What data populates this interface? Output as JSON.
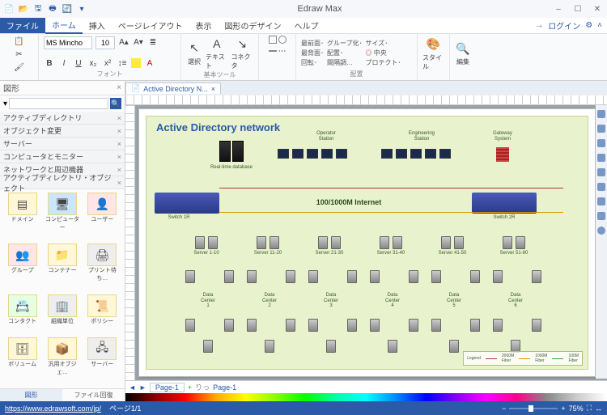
{
  "app": {
    "title": "Edraw Max"
  },
  "window_controls": {
    "min": "–",
    "max": "☐",
    "close": "✕"
  },
  "qat": [
    "📄",
    "📂",
    "🖫",
    "🖶",
    "🔄",
    "▾"
  ],
  "login": {
    "arrow": "→",
    "label": "ログイン"
  },
  "tabs": {
    "file": "ファイル",
    "home": "ホーム",
    "insert": "挿入",
    "pagelayout": "ページレイアウト",
    "view": "表示",
    "design": "図形のデザイン",
    "help": "ヘルプ"
  },
  "ribbon": {
    "font": {
      "name": "MS Mincho",
      "size": "10",
      "bold": "B",
      "italic": "I",
      "underline": "U",
      "label": "フォント"
    },
    "tools": {
      "select": "選択",
      "text": "テキスト",
      "connector": "コネクタ",
      "label": "基本ツール"
    },
    "arrange": {
      "items": [
        "最前面･",
        "グループ化･",
        "サイズ･",
        "最背面･",
        "配置･",
        "中央",
        "回転･",
        "間隔調…",
        "プロテクト･"
      ],
      "center": "中央",
      "label": "配置"
    },
    "style": {
      "label": "スタイル"
    },
    "edit": {
      "label": "編集"
    }
  },
  "shapes_panel": {
    "title": "図形",
    "search_placeholder": "",
    "categories": [
      "アクティブディレクトリ",
      "オブジェクト変更",
      "サーバー",
      "コンピュータとモニター",
      "ネットワークと周辺機器",
      "アクティブディレクトリ・オブジェクト"
    ],
    "items": [
      "ドメイン",
      "コンピューター",
      "ユーザー",
      "グループ",
      "コンテナー",
      "プリント待ち…",
      "コンタクト",
      "組織単位",
      "ポリシー",
      "ボリューム",
      "汎用オブジェ…",
      "サーバー"
    ],
    "foot": {
      "shapes": "図形",
      "recall": "ファイル回復"
    }
  },
  "doc": {
    "tab": "Active Directory N...",
    "close": "×"
  },
  "diagram": {
    "title": "Active Directory network",
    "rtdb": "Real-time database",
    "opstation": "Operator\nStation",
    "engstation": "Engineering\nStation",
    "gateway": "Gateway\nSystem",
    "backbone": "100/1000M Internet",
    "switch1": "Switch 1R",
    "switch2": "Switch 2R",
    "servers": [
      "Server 1-10",
      "Server 11-20",
      "Server 21-30",
      "Server 31-40",
      "Server 41-50",
      "Server 51-60"
    ],
    "dcs": [
      "Data\nCenter\n1",
      "Data\nCenter\n2",
      "Data\nCenter\n3",
      "Data\nCenter\n4",
      "Data\nCenter\n5",
      "Data\nCenter\n6"
    ],
    "legend": {
      "title": "Legend",
      "a": "2000M\nFiber",
      "b": "1000M\nFiber",
      "c": "100M\nFiber"
    }
  },
  "pagetabs": {
    "p1": "Page-1",
    "p1b": "Page-1",
    "add": "+",
    "cycle": "りっ"
  },
  "status": {
    "url": "https://www.edrawsoft.com/jp/",
    "page": "ページ1/1",
    "zoom": "75%"
  }
}
